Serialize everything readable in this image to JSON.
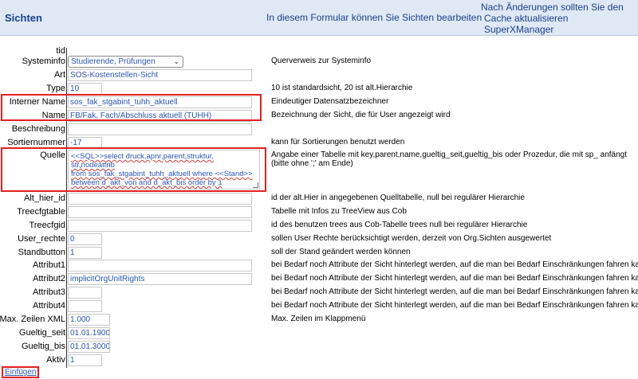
{
  "header": {
    "title": "Sichten",
    "note": "In diesem Formular können Sie Sichten bearbeiten",
    "cache_line1": "Nach Änderungen sollten Sie den",
    "cache_line2": "Cache aktualisieren",
    "cache_line3": "SuperXManager"
  },
  "fields": {
    "tid": {
      "label": "tid"
    },
    "systeminfo": {
      "label": "Systeminfo",
      "value": "Studierende, Prüfungen",
      "desc": "Querverweis zur Systeminfo"
    },
    "art": {
      "label": "Art",
      "value": "SOS-Kostenstellen-Sicht"
    },
    "type": {
      "label": "Type",
      "value": "10",
      "desc": "10 ist standardsicht, 20 ist alt.Hierarchie"
    },
    "interner_name": {
      "label": "Interner Name",
      "value": "sos_fak_stgabint_tuhh_aktuell",
      "desc": "Eindeutiger Datensatzbezeichner"
    },
    "name": {
      "label": "Name",
      "value": "FB/Fak, Fach/Abschluss aktuell (TUHH)",
      "desc": "Bezeichnung der Sicht, die für User angezeigt wird"
    },
    "beschreibung": {
      "label": "Beschreibung"
    },
    "sortiernummer": {
      "label": "Sortiernummer",
      "value": "-17",
      "desc": "kann für Sortierungen benutzt werden"
    },
    "quelle": {
      "label": "Quelle",
      "value_line1": "<<SQL>>select druck,apnr,parent,struktur, str,nodeattrib",
      "value_line2": "from sos_fak_stgabint_tuhh_aktuell where <<Stand>>",
      "value_line3": "between d_akt_von and d_akt_bis  order by 1",
      "desc_line1": "Angabe einer Tabelle mit key,parent,name,gueltig_seit,gueltig_bis oder Prozedur, die mit sp_ anfängt",
      "desc_line2": "(bitte ohne ';' am Ende)"
    },
    "alt_hier_id": {
      "label": "Alt_hier_id",
      "desc": "id der alt.Hier in angegebenen Quelltabelle, null bei regulärer Hierarchie"
    },
    "treecfgtable": {
      "label": "Treecfgtable",
      "desc": "Tabelle mit Infos zu TreeView aus Cob"
    },
    "treecfgid": {
      "label": "Treecfgid",
      "desc": "id des benutzen trees aus Cob-Tabelle trees null bei regulärer Hierarchie"
    },
    "user_rechte": {
      "label": "User_rechte",
      "value": "0",
      "desc": "sollen User Rechte berücksichtigt werden, derzeit von Org.Sichten ausgewertet"
    },
    "standbutton": {
      "label": "Standbutton",
      "value": "1",
      "desc": "soll der Stand geändert werden können"
    },
    "attribut1": {
      "label": "Attribut1",
      "desc": "bei Bedarf noch Attribute der Sicht hinterlegt werden, auf die man bei Bedarf Einschränkungen fahren kann"
    },
    "attribut2": {
      "label": "Attribut2",
      "value": "implicitOrgUnitRights",
      "desc": "bei Bedarf noch Attribute der Sicht hinterlegt werden, auf die man bei Bedarf Einschränkungen fahren kann"
    },
    "attribut3": {
      "label": "Attribut3",
      "desc": "bei Bedarf noch Attribute der Sicht hinterlegt werden, auf die man bei Bedarf Einschränkungen fahren kann"
    },
    "attribut4": {
      "label": "Attribut4",
      "desc": "bei Bedarf noch Attribute der Sicht hinterlegt werden, auf die man bei Bedarf Einschränkungen fahren kann"
    },
    "max_zeilen": {
      "label": "Max. Zeilen XML",
      "value": "1.000",
      "desc": "Max. Zeilen im Klappmenü"
    },
    "gueltig_seit": {
      "label": "Gueltig_seit",
      "value": "01.01.1900"
    },
    "gueltig_bis": {
      "label": "Gueltig_bis",
      "value": "01.01.3000"
    },
    "aktiv": {
      "label": "Aktiv",
      "value": "1"
    }
  },
  "actions": {
    "einfuegen": "Einfügen"
  },
  "colors": {
    "header_bg": "#dfe9f5",
    "header_text": "#1a3f8a",
    "value_text": "#2a56b0",
    "highlight": "#e52020"
  }
}
